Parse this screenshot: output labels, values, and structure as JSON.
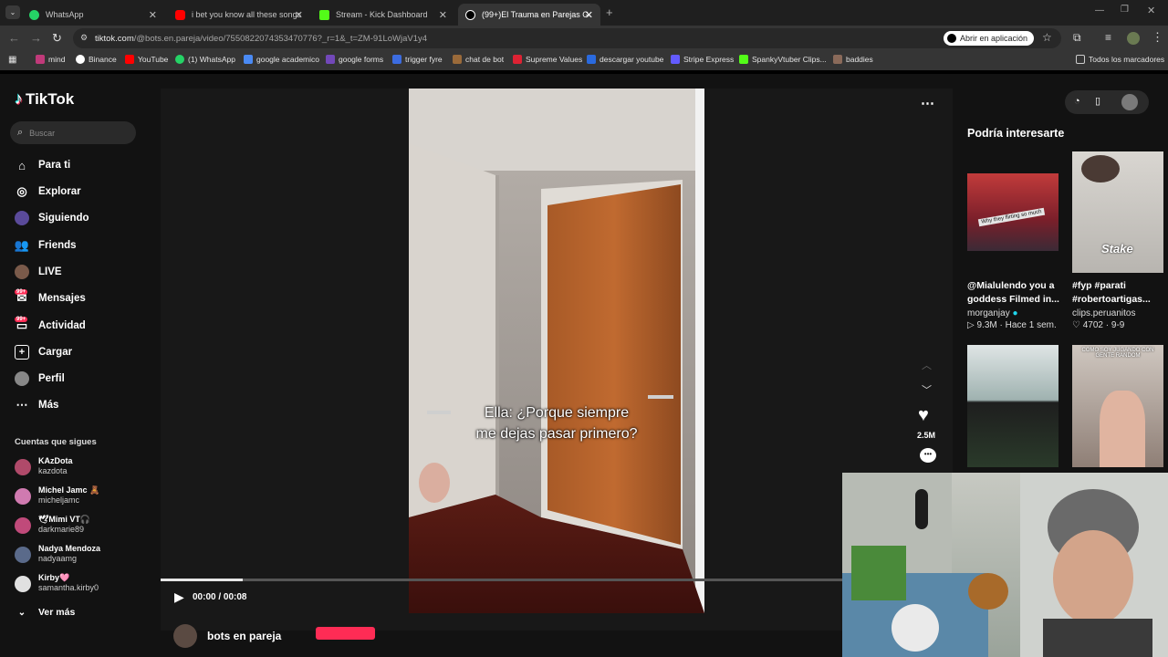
{
  "browser": {
    "tabs": [
      {
        "label": "WhatsApp",
        "color": "#25d366"
      },
      {
        "label": "i bet you know all these songs",
        "color": "#ff0000"
      },
      {
        "label": "Stream - Kick Dashboard",
        "color": "#53fc18"
      },
      {
        "label": "(99+)El Trauma en Parejas Gam",
        "color": "#ffffff"
      }
    ],
    "url_host": "tiktok.com",
    "url_path": "/@bots.en.pareja/video/7550822074353470776?_r=1&_t=ZM-91LoWjaV1y4",
    "open_app": "Abrir en aplicación",
    "bookmarks": [
      "mind",
      "Binance",
      "YouTube",
      "(1) WhatsApp",
      "google academico",
      "google forms",
      "trigger fyre",
      "chat de bot",
      "Supreme Values",
      "descargar youtube",
      "Stripe Express",
      "SpankyVtuber Clips...",
      "baddies"
    ],
    "all_bookmarks": "Todos los marcadores"
  },
  "sidebar": {
    "logo": "TikTok",
    "search_placeholder": "Buscar",
    "nav": [
      {
        "label": "Para ti",
        "icon": "home-icon"
      },
      {
        "label": "Explorar",
        "icon": "compass-icon"
      },
      {
        "label": "Siguiendo",
        "icon": "following-icon"
      },
      {
        "label": "Friends",
        "icon": "friends-icon"
      },
      {
        "label": "LIVE",
        "icon": "live-icon"
      },
      {
        "label": "Mensajes",
        "icon": "message-icon"
      },
      {
        "label": "Actividad",
        "icon": "activity-icon"
      },
      {
        "label": "Cargar",
        "icon": "upload-icon"
      },
      {
        "label": "Perfil",
        "icon": "profile-icon"
      },
      {
        "label": "Más",
        "icon": "more-icon"
      }
    ],
    "badges": [
      "99+",
      "99+"
    ],
    "following_title": "Cuentas que sigues",
    "following": [
      {
        "name": "KAzDota",
        "user": "kazdota"
      },
      {
        "name": "Michel Jamc 🧸",
        "user": "micheljamc"
      },
      {
        "name": "🕊Mimi VT🎧",
        "user": "darkmarie89"
      },
      {
        "name": "Nadya Mendoza",
        "user": "nadyaamg"
      },
      {
        "name": "Kirby🩷",
        "user": "samantha.kirby0"
      }
    ],
    "see_more": "Ver más"
  },
  "player": {
    "caption_line1": "Ella: ¿Porque siempre",
    "caption_line2": "me dejas pasar primero?",
    "time": "00:00 / 00:08",
    "progress": 0.12,
    "likes": "2.5M",
    "author": "bots en pareja"
  },
  "recommended": {
    "title": "Podría interesarte",
    "items": [
      {
        "title": "@Mialulendo you a goddess Filmed in...",
        "author": "morganjay",
        "meta": "9.3M · Hace 1 sem.",
        "overlay": "Why they flirting so much"
      },
      {
        "title": "#fyp #parati #robertoartigas...",
        "author": "clips.peruanitos",
        "meta": "4702 · 9-9",
        "overlay": "Stake"
      }
    ],
    "row2_overlay": "COMO SOY JUGANDO CON GENTE RANDOM"
  }
}
